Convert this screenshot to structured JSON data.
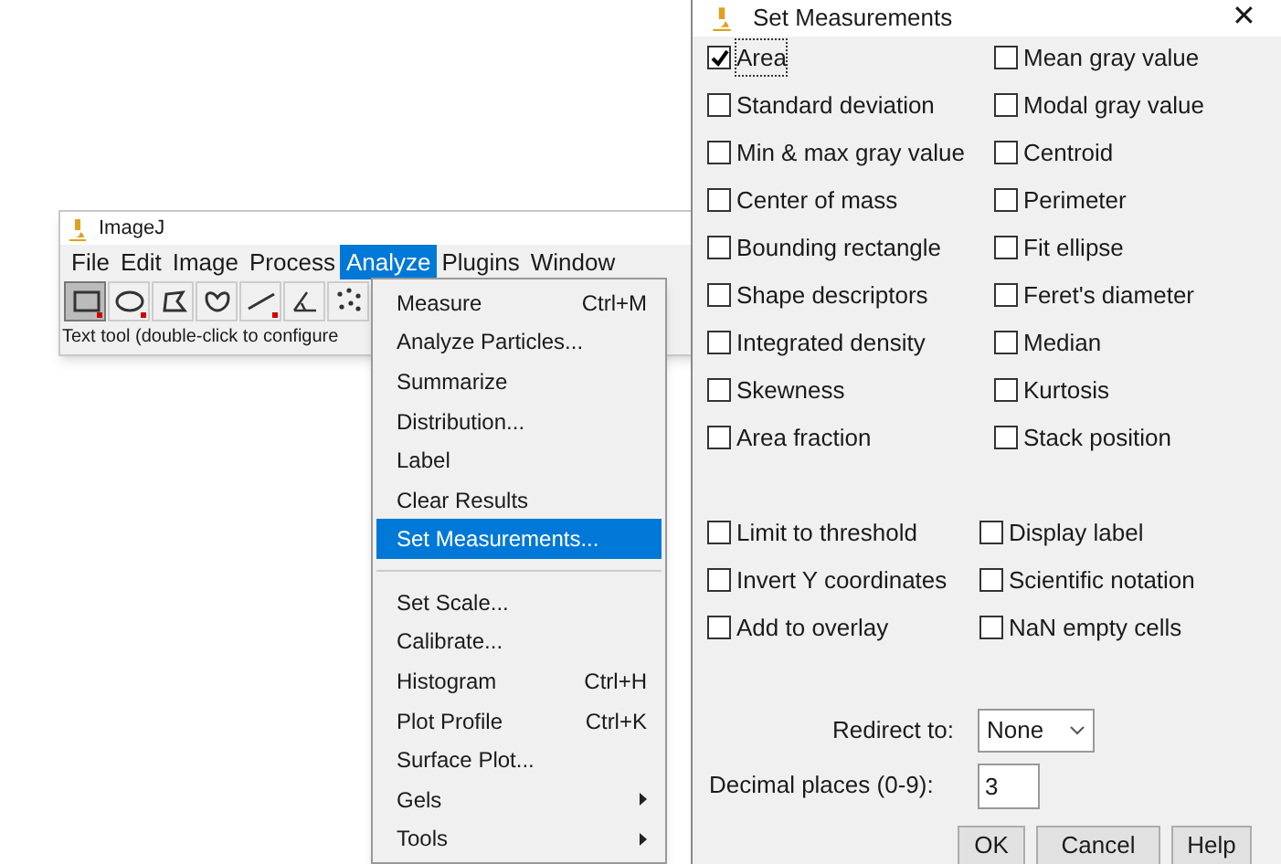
{
  "imagej_window": {
    "title": "ImageJ",
    "menus": [
      {
        "label": "File",
        "selected": false
      },
      {
        "label": "Edit",
        "selected": false
      },
      {
        "label": "Image",
        "selected": false
      },
      {
        "label": "Process",
        "selected": false
      },
      {
        "label": "Analyze",
        "selected": true
      },
      {
        "label": "Plugins",
        "selected": false
      },
      {
        "label": "Window",
        "selected": false
      }
    ],
    "tools": [
      {
        "kind": "rectangle",
        "selected": true,
        "has_menu": true
      },
      {
        "kind": "oval",
        "selected": false,
        "has_menu": true
      },
      {
        "kind": "polygon",
        "selected": false,
        "has_menu": false
      },
      {
        "kind": "freehand",
        "selected": false,
        "has_menu": false
      },
      {
        "kind": "line",
        "selected": false,
        "has_menu": true
      },
      {
        "kind": "angle",
        "selected": false,
        "has_menu": false
      },
      {
        "kind": "multipoint",
        "selected": false,
        "has_menu": false
      }
    ],
    "status": "Text tool (double-click to configure"
  },
  "analyze_menu": {
    "sections": [
      [
        {
          "label": "Measure",
          "shortcut": "Ctrl+M",
          "submenu": false,
          "selected": false
        },
        {
          "label": "Analyze Particles...",
          "submenu": false,
          "selected": false
        },
        {
          "label": "Summarize",
          "submenu": false,
          "selected": false
        },
        {
          "label": "Distribution...",
          "submenu": false,
          "selected": false
        },
        {
          "label": "Label",
          "submenu": false,
          "selected": false
        },
        {
          "label": "Clear Results",
          "submenu": false,
          "selected": false
        },
        {
          "label": "Set Measurements...",
          "submenu": false,
          "selected": true
        }
      ],
      [
        {
          "label": "Set Scale...",
          "submenu": false,
          "selected": false
        },
        {
          "label": "Calibrate...",
          "submenu": false,
          "selected": false
        },
        {
          "label": "Histogram",
          "shortcut": "Ctrl+H",
          "submenu": false,
          "selected": false
        },
        {
          "label": "Plot Profile",
          "shortcut": "Ctrl+K",
          "submenu": false,
          "selected": false
        },
        {
          "label": "Surface Plot...",
          "submenu": false,
          "selected": false
        },
        {
          "label": "Gels",
          "submenu": true,
          "selected": false
        },
        {
          "label": "Tools",
          "submenu": true,
          "selected": false
        }
      ]
    ]
  },
  "dialog": {
    "title": "Set Measurements",
    "close": "✕",
    "measurements": [
      {
        "label": "Area",
        "checked": true,
        "focused": true
      },
      {
        "label": "Mean gray value",
        "checked": false,
        "focused": false
      },
      {
        "label": "Standard deviation",
        "checked": false,
        "focused": false
      },
      {
        "label": "Modal gray value",
        "checked": false,
        "focused": false
      },
      {
        "label": "Min & max gray value",
        "checked": false,
        "focused": false
      },
      {
        "label": "Centroid",
        "checked": false,
        "focused": false
      },
      {
        "label": "Center of mass",
        "checked": false,
        "focused": false
      },
      {
        "label": "Perimeter",
        "checked": false,
        "focused": false
      },
      {
        "label": "Bounding rectangle",
        "checked": false,
        "focused": false
      },
      {
        "label": "Fit ellipse",
        "checked": false,
        "focused": false
      },
      {
        "label": "Shape descriptors",
        "checked": false,
        "focused": false
      },
      {
        "label": "Feret's diameter",
        "checked": false,
        "focused": false
      },
      {
        "label": "Integrated density",
        "checked": false,
        "focused": false
      },
      {
        "label": "Median",
        "checked": false,
        "focused": false
      },
      {
        "label": "Skewness",
        "checked": false,
        "focused": false
      },
      {
        "label": "Kurtosis",
        "checked": false,
        "focused": false
      },
      {
        "label": "Area fraction",
        "checked": false,
        "focused": false
      },
      {
        "label": "Stack position",
        "checked": false,
        "focused": false
      }
    ],
    "options": [
      {
        "label": "Limit to threshold",
        "checked": false
      },
      {
        "label": "Display label",
        "checked": false
      },
      {
        "label": "Invert Y coordinates",
        "checked": false
      },
      {
        "label": "Scientific notation",
        "checked": false
      },
      {
        "label": "Add to overlay",
        "checked": false
      },
      {
        "label": "NaN empty cells",
        "checked": false
      }
    ],
    "redirect_to": {
      "label": "Redirect to:",
      "value": "None"
    },
    "decimal_places": {
      "label": "Decimal places (0-9):",
      "value": "3"
    },
    "buttons": [
      "OK",
      "Cancel",
      "Help"
    ]
  }
}
